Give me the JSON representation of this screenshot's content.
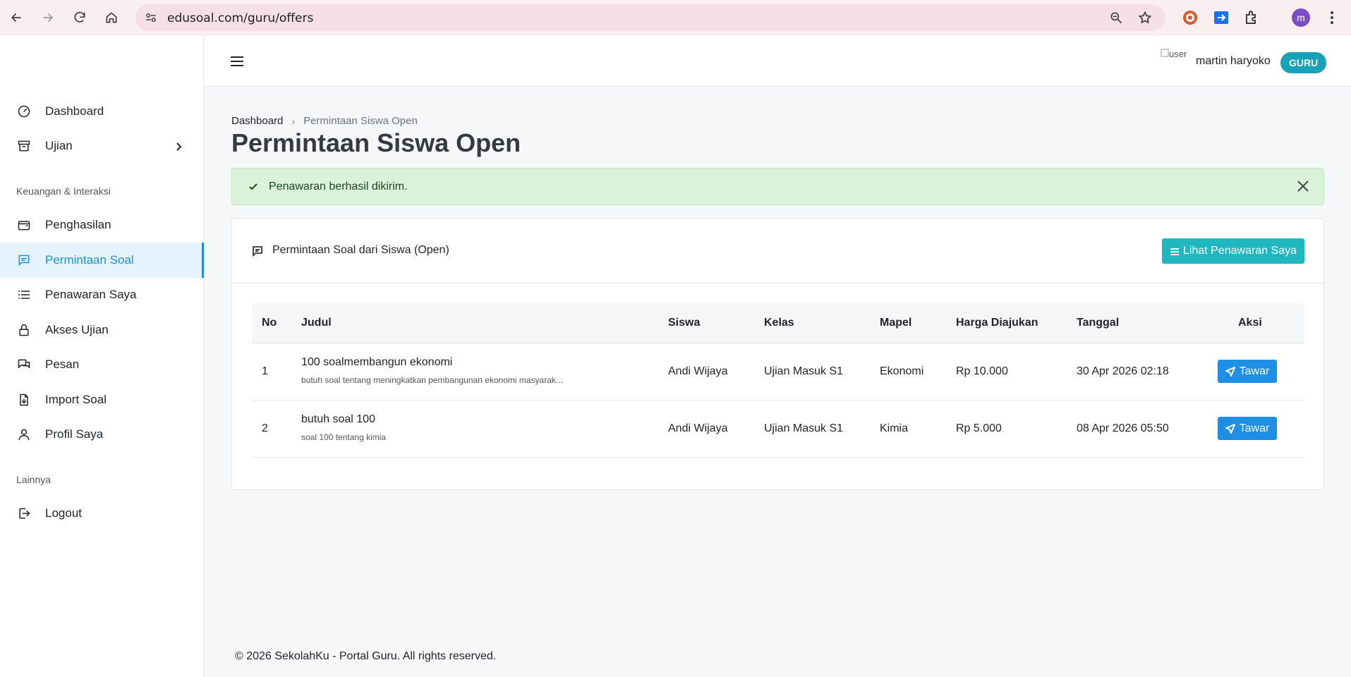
{
  "browser": {
    "url": "edusoal.com/guru/offers",
    "profile_initial": "m"
  },
  "sidebar": {
    "items": [
      {
        "label": "Dashboard",
        "icon": "dashboard-icon"
      },
      {
        "label": "Ujian",
        "icon": "archive-icon"
      },
      {
        "label": "Penghasilan",
        "icon": "wallet-icon"
      },
      {
        "label": "Permintaan Soal",
        "icon": "chat-icon"
      },
      {
        "label": "Penawaran Saya",
        "icon": "list-icon"
      },
      {
        "label": "Akses Ujian",
        "icon": "lock-icon"
      },
      {
        "label": "Pesan",
        "icon": "message-icon"
      },
      {
        "label": "Import Soal",
        "icon": "import-icon"
      },
      {
        "label": "Profil Saya",
        "icon": "user-icon"
      },
      {
        "label": "Logout",
        "icon": "logout-icon"
      }
    ],
    "section_finance": "Keuangan & Interaksi",
    "section_other": "Lainnya"
  },
  "header": {
    "user_img_alt": "user",
    "user_name": "martin haryoko",
    "role": "GURU"
  },
  "breadcrumb": {
    "home": "Dashboard",
    "current": "Permintaan Siswa Open"
  },
  "page": {
    "title": "Permintaan Siswa Open"
  },
  "alert": {
    "message": "Penawaran berhasil dikirim.",
    "color": "#d9f2d9"
  },
  "card": {
    "title": "Permintaan Soal dari Siswa (Open)",
    "button": "Lihat Penawaran Saya"
  },
  "table": {
    "headers": [
      "No",
      "Judul",
      "Siswa",
      "Kelas",
      "Mapel",
      "Harga Diajukan",
      "Tanggal",
      "Aksi"
    ],
    "rows": [
      {
        "no": "1",
        "title": "100 soalmembangun ekonomi",
        "desc": "butuh soal tentang meningkatkan pembangunan ekonomi masyarak...",
        "siswa": "Andi Wijaya",
        "kelas": "Ujian Masuk S1",
        "mapel": "Ekonomi",
        "harga": "Rp 10.000",
        "tanggal": "30 Apr 2026 02:18",
        "action": "Tawar"
      },
      {
        "no": "2",
        "title": "butuh soal 100",
        "desc": "soal 100 tentang kimia",
        "siswa": "Andi Wijaya",
        "kelas": "Ujian Masuk S1",
        "mapel": "Kimia",
        "harga": "Rp 5.000",
        "tanggal": "08 Apr 2026 05:50",
        "action": "Tawar"
      }
    ]
  },
  "footer": {
    "text": "© 2026 SekolahKu - Portal Guru. All rights reserved."
  },
  "colors": {
    "accent": "#1f8fd6",
    "teal": "#1fb8c0",
    "blue_button": "#1f8fe6",
    "badge": "#17a2b8"
  }
}
